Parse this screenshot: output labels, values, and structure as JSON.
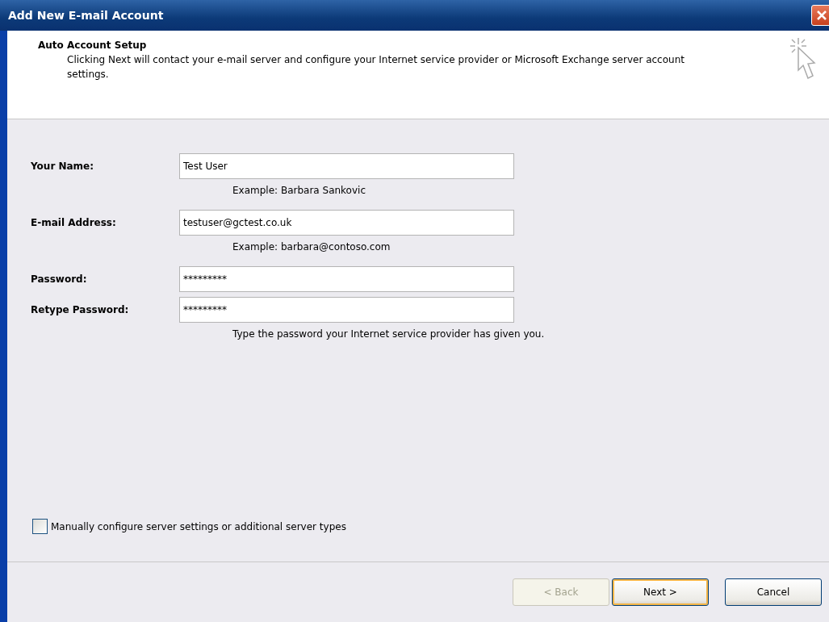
{
  "window": {
    "title": "Add New E-mail Account"
  },
  "header": {
    "title": "Auto Account Setup",
    "description": "Clicking Next will contact your e-mail server and configure your Internet service provider or Microsoft Exchange server account settings."
  },
  "fields": [
    {
      "label": "Your Name:",
      "value": "Test User",
      "hint": "Example: Barbara Sankovic"
    },
    {
      "label": "E-mail Address:",
      "value": "testuser@gctest.co.uk",
      "hint": "Example: barbara@contoso.com"
    },
    {
      "label": "Password:",
      "value": "*********"
    },
    {
      "label": "Retype Password:",
      "value": "*********",
      "hint": "Type the password your Internet service provider has given you."
    }
  ],
  "manual_config": {
    "label": "Manually configure server settings or additional server types",
    "checked": false
  },
  "buttons": [
    {
      "label": "< Back",
      "disabled": true,
      "default": false
    },
    {
      "label": "Next >",
      "disabled": false,
      "default": true
    },
    {
      "label": "Cancel",
      "disabled": false,
      "default": false
    }
  ]
}
